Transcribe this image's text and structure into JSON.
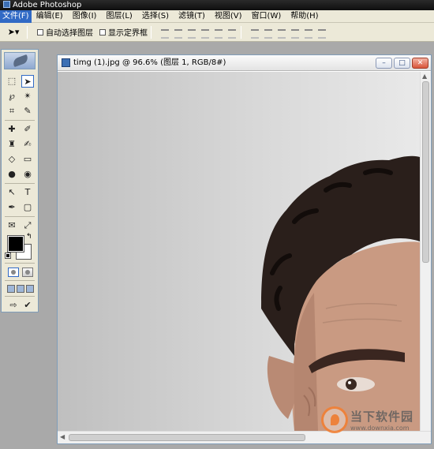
{
  "app": {
    "title": "Adobe Photoshop"
  },
  "menu": [
    {
      "label": "文件(F)",
      "active": true
    },
    {
      "label": "编辑(E)"
    },
    {
      "label": "图像(I)"
    },
    {
      "label": "图层(L)"
    },
    {
      "label": "选择(S)"
    },
    {
      "label": "滤镜(T)"
    },
    {
      "label": "视图(V)"
    },
    {
      "label": "窗口(W)"
    },
    {
      "label": "帮助(H)"
    }
  ],
  "options": {
    "tool_preset_icon": "move-tool-icon",
    "auto_select_label": "自动选择图层",
    "show_bounds_label": "显示定界框"
  },
  "document": {
    "title": "timg (1).jpg @ 96.6% (图层 1, RGB/8#)",
    "buttons": {
      "minimize": "–",
      "restore": "□",
      "close": "✕"
    }
  },
  "toolbox": {
    "tools": [
      "marquee-tool",
      "move-tool",
      "lasso-tool",
      "magic-wand-tool",
      "crop-tool",
      "slice-tool",
      "healing-brush-tool",
      "brush-tool",
      "clone-stamp-tool",
      "history-brush-tool",
      "eraser-tool",
      "gradient-tool",
      "blur-tool",
      "dodge-tool",
      "path-selection-tool",
      "type-tool",
      "pen-tool",
      "shape-tool",
      "notes-tool",
      "eyedropper-tool",
      "hand-tool",
      "zoom-tool"
    ],
    "foreground_color": "#000000",
    "background_color": "#ffffff"
  },
  "watermark": {
    "main": "当下软件园",
    "sub": "www.downxia.com"
  }
}
